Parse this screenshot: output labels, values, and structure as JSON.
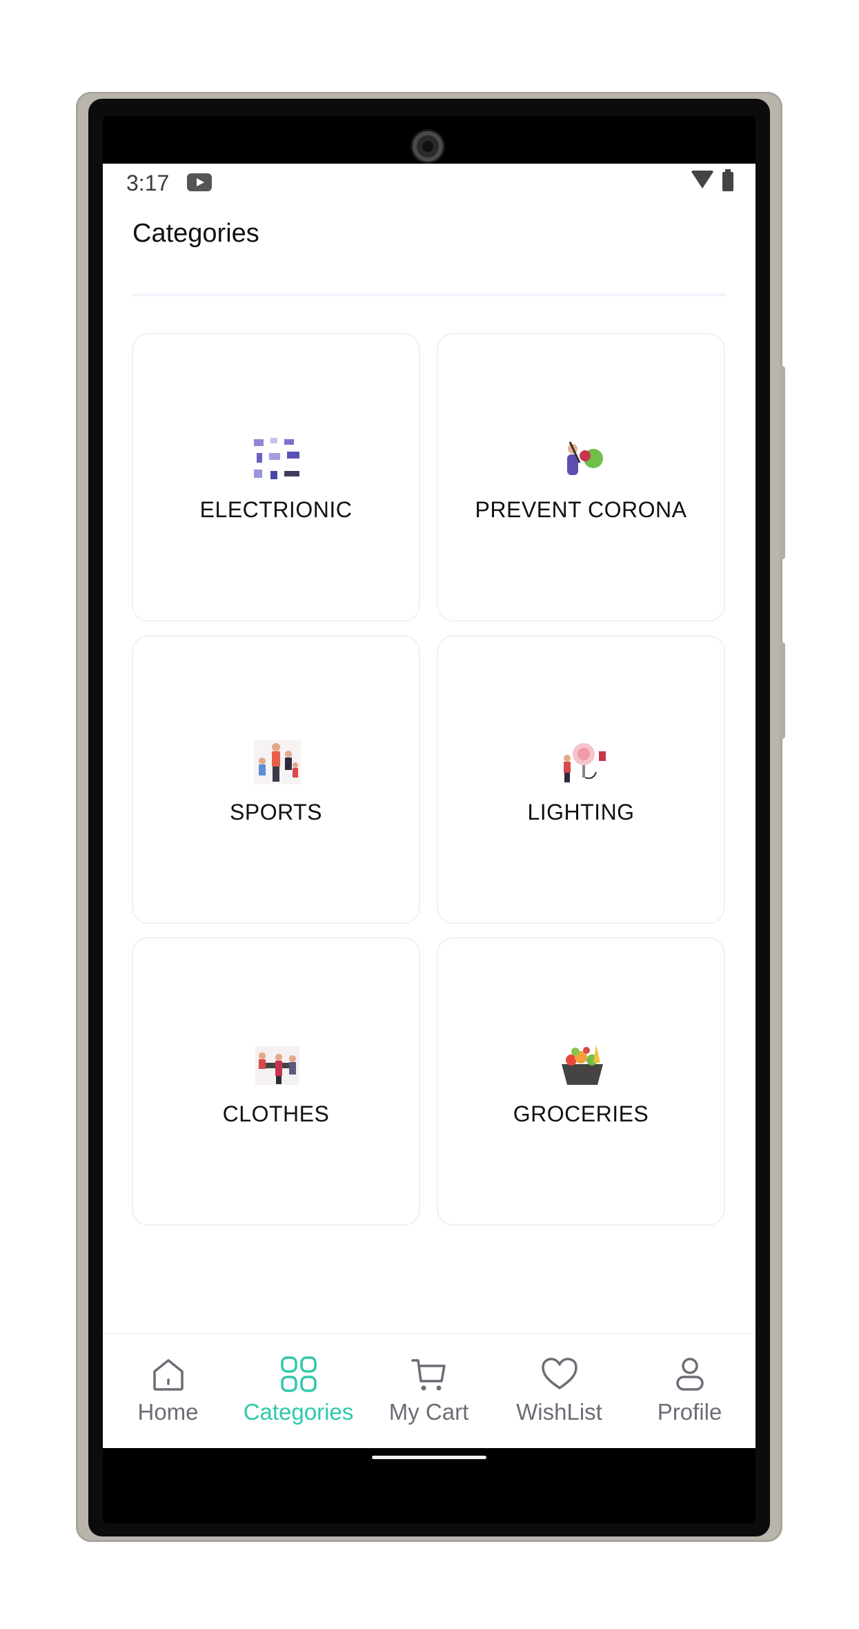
{
  "status_bar": {
    "time": "3:17",
    "icons": [
      "youtube-icon",
      "wifi-icon",
      "battery-icon"
    ]
  },
  "page": {
    "title": "Categories"
  },
  "categories": [
    {
      "label": "ELECTRIONIC",
      "image": "electronics-illustration"
    },
    {
      "label": "PREVENT CORONA",
      "image": "prevent-corona-illustration"
    },
    {
      "label": "SPORTS",
      "image": "sports-illustration"
    },
    {
      "label": "LIGHTING",
      "image": "lighting-illustration"
    },
    {
      "label": "CLOTHES",
      "image": "clothes-illustration"
    },
    {
      "label": "GROCERIES",
      "image": "groceries-illustration"
    }
  ],
  "bottom_nav": {
    "items": [
      {
        "label": "Home",
        "icon": "home-icon"
      },
      {
        "label": "Categories",
        "icon": "categories-icon",
        "active": true
      },
      {
        "label": "My Cart",
        "icon": "cart-icon"
      },
      {
        "label": "WishList",
        "icon": "heart-icon"
      },
      {
        "label": "Profile",
        "icon": "profile-icon"
      }
    ],
    "active_color": "#2ec9a9",
    "inactive_color": "#6c6c76"
  }
}
